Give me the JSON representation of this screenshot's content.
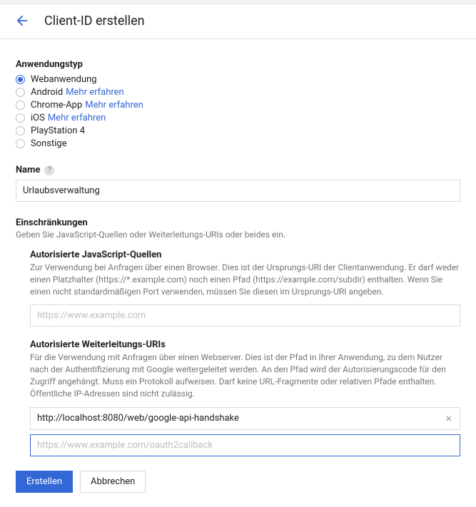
{
  "header": {
    "title": "Client-ID erstellen"
  },
  "app_type": {
    "label": "Anwendungstyp",
    "options": [
      {
        "label": "Webanwendung",
        "selected": true,
        "learn": null
      },
      {
        "label": "Android",
        "selected": false,
        "learn": "Mehr erfahren"
      },
      {
        "label": "Chrome-App",
        "selected": false,
        "learn": "Mehr erfahren"
      },
      {
        "label": "iOS",
        "selected": false,
        "learn": "Mehr erfahren"
      },
      {
        "label": "PlayStation 4",
        "selected": false,
        "learn": null
      },
      {
        "label": "Sonstige",
        "selected": false,
        "learn": null
      }
    ]
  },
  "name": {
    "label": "Name",
    "value": "Urlaubsverwaltung"
  },
  "restrictions": {
    "title": "Einschränkungen",
    "help": "Geben Sie JavaScript-Quellen oder Weiterleitungs-URIs oder beides ein."
  },
  "js_origins": {
    "title": "Autorisierte JavaScript-Quellen",
    "help": "Zur Verwendung bei Anfragen über einen Browser. Dies ist der Ursprungs-URI der Clientanwendung. Er darf weder einen Platzhalter (https://*.example.com) noch einen Pfad (https://example.com/subdir) enthalten. Wenn Sie einen nicht standardmäßigen Port verwenden, müssen Sie diesen im Ursprungs-URI angeben.",
    "placeholder": "https://www.example.com"
  },
  "redirect_uris": {
    "title": "Autorisierte Weiterleitungs-URIs",
    "help": "Für die Verwendung mit Anfragen über einen Webserver. Dies ist der Pfad in Ihrer Anwendung, zu dem Nutzer nach der Authentifizierung mit Google weitergeleitet werden. An den Pfad wird der Autorisierungscode für den Zugriff angehängt. Muss ein Protokoll aufweisen. Darf keine URL-Fragmente oder relativen Pfade enthalten. Öffentliche IP-Adressen sind nicht zulässig.",
    "entries": [
      {
        "value": "http://localhost:8080/web/google-api-handshake"
      }
    ],
    "placeholder": "https://www.example.com/oauth2callback"
  },
  "buttons": {
    "create": "Erstellen",
    "cancel": "Abbrechen"
  }
}
